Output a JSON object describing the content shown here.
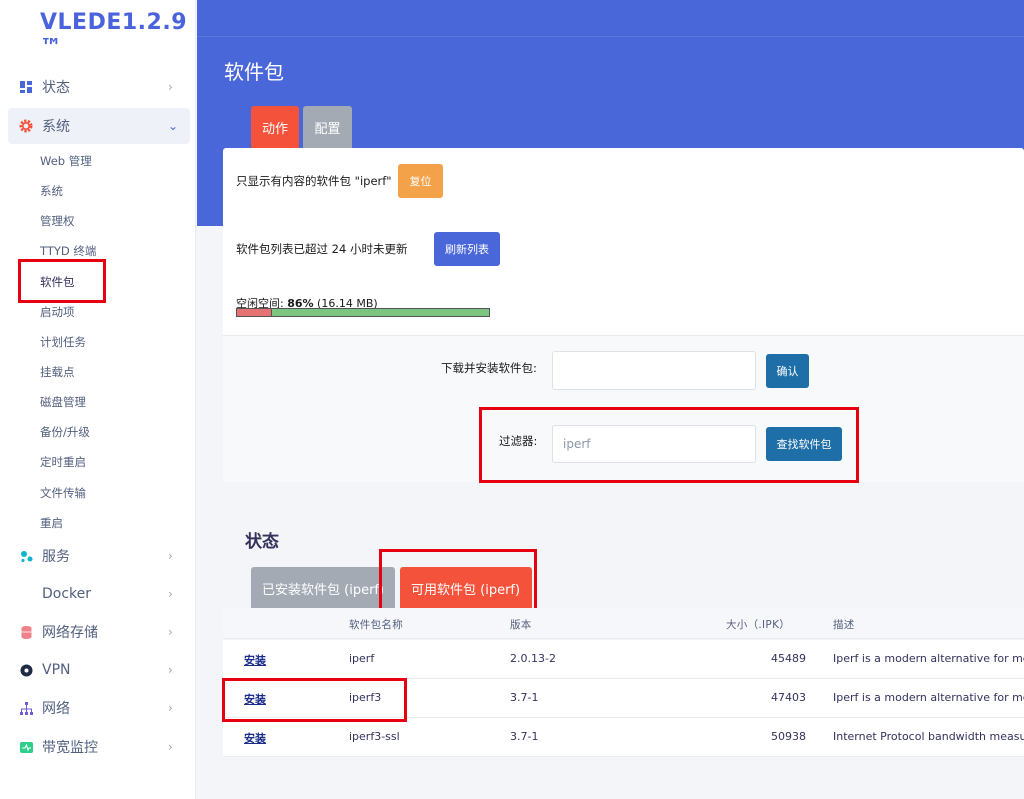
{
  "brand": "VLEDE1.2.9 ™",
  "sidebar": {
    "items": [
      {
        "label": "状态",
        "icon": "dashboard-icon"
      },
      {
        "label": "系统",
        "icon": "gear-icon"
      },
      {
        "label": "服务",
        "icon": "services-icon"
      },
      {
        "label": "Docker",
        "icon": ""
      },
      {
        "label": "网络存储",
        "icon": "storage-icon"
      },
      {
        "label": "VPN",
        "icon": "vpn-icon"
      },
      {
        "label": "网络",
        "icon": "network-icon"
      },
      {
        "label": "带宽监控",
        "icon": "bandwidth-icon"
      }
    ],
    "sub_items": [
      "Web 管理",
      "系统",
      "管理权",
      "TTYD 终端",
      "软件包",
      "启动项",
      "计划任务",
      "挂载点",
      "磁盘管理",
      "备份/升级",
      "定时重启",
      "文件传输",
      "重启"
    ]
  },
  "page": {
    "title": "软件包",
    "tabs": [
      "动作",
      "配置"
    ]
  },
  "actions": {
    "filter_text": "只显示有内容的软件包 \"iperf\"",
    "reset_label": "复位",
    "list_text": "软件包列表已超过 24 小时未更新",
    "refresh_label": "刷新列表",
    "space_prefix": "空闲空间: ",
    "space_percent": "86%",
    "space_size": " (16.14 MB)",
    "free_fraction": 0.86,
    "download_label": "下载并安装软件包:",
    "download_value": "",
    "confirm_label": "确认",
    "filter_label": "过滤器:",
    "filter_value": "iperf",
    "find_label": "查找软件包"
  },
  "status": {
    "title": "状态",
    "tabs": [
      "已安装软件包 (iperf)",
      "可用软件包 (iperf)"
    ],
    "columns": [
      "软件包名称",
      "版本",
      "大小（.IPK）",
      "描述"
    ],
    "rows": [
      {
        "action": "安装",
        "name": "iperf",
        "version": "2.0.13-2",
        "size": "45489",
        "desc": "Iperf is a modern alternative for meas"
      },
      {
        "action": "安装",
        "name": "iperf3",
        "version": "3.7-1",
        "size": "47403",
        "desc": "Iperf is a modern alternative for meas"
      },
      {
        "action": "安装",
        "name": "iperf3-ssl",
        "version": "3.7-1",
        "size": "50938",
        "desc": "Internet Protocol bandwidth measurin"
      }
    ]
  },
  "colors": {
    "accent": "#4a67d9",
    "tab_active": "#f4523b",
    "tab_inactive": "#a3aab4",
    "reset": "#f4a24a",
    "refresh": "#4a67d9",
    "confirm": "#1e6fa8",
    "highlight": "#e60012"
  }
}
